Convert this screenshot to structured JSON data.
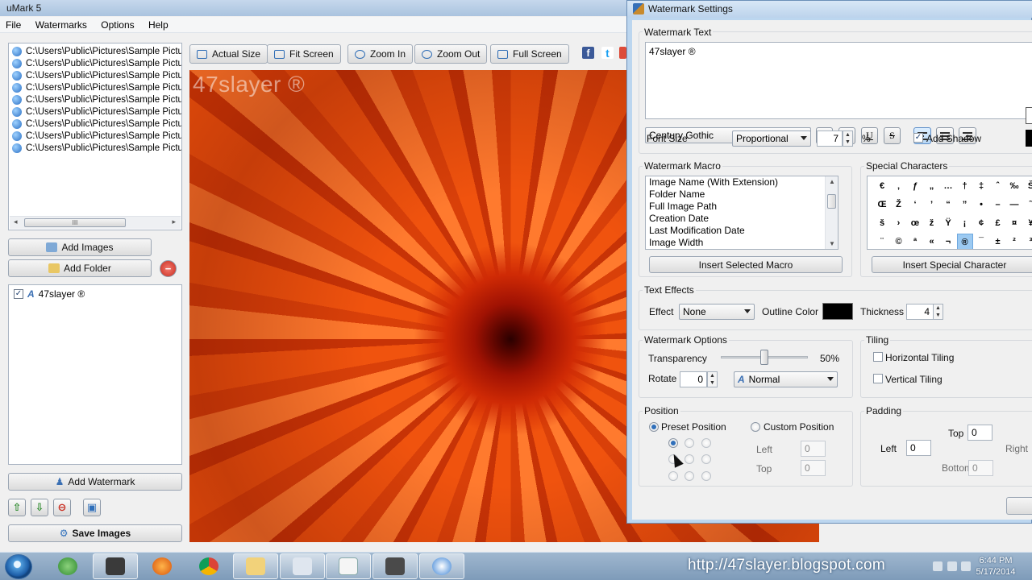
{
  "app": {
    "title": "uMark 5"
  },
  "menu": [
    "File",
    "Watermarks",
    "Options",
    "Help"
  ],
  "files": [
    "C:\\Users\\Public\\Pictures\\Sample Pictur",
    "C:\\Users\\Public\\Pictures\\Sample Pictur",
    "C:\\Users\\Public\\Pictures\\Sample Pictur",
    "C:\\Users\\Public\\Pictures\\Sample Pictur",
    "C:\\Users\\Public\\Pictures\\Sample Pictur",
    "C:\\Users\\Public\\Pictures\\Sample Pictur",
    "C:\\Users\\Public\\Pictures\\Sample Pictur",
    "C:\\Users\\Public\\Pictures\\Sample Pictur",
    "C:\\Users\\Public\\Pictures\\Sample Pictur"
  ],
  "scroll_thumb_label": "III",
  "left_buttons": {
    "add_images": "Add Images",
    "add_folder": "Add Folder",
    "add_watermark": "Add Watermark",
    "save_images": "Save Images"
  },
  "watermarks": [
    {
      "name": "47slayer ®",
      "checked": true
    }
  ],
  "toolbar": {
    "actual_size": "Actual Size",
    "fit_screen": "Fit Screen",
    "zoom_in": "Zoom In",
    "zoom_out": "Zoom Out",
    "full_screen": "Full Screen"
  },
  "preview": {
    "watermark_text": "47slayer ®"
  },
  "dialog": {
    "title": "Watermark Settings",
    "watermark_text_label": "Watermark Text",
    "watermark_text": "47slayer ®",
    "font": "Century Gothic",
    "format": {
      "bold": "B",
      "italic": "I",
      "underline": "U",
      "strike": "S"
    },
    "font_size_label": "Font Size",
    "font_size_mode": "Proportional",
    "font_size_value": "7",
    "font_size_unit": "%",
    "add_shadow_label": "Add Shadow",
    "add_shadow": true,
    "macro_label": "Watermark Macro",
    "macros": [
      "Image Name (With Extension)",
      "Folder Name",
      "Full Image Path",
      "Creation Date",
      "Last Modification Date",
      "Image Width"
    ],
    "insert_macro": "Insert Selected Macro",
    "special_label": "Special Characters",
    "special_rows": [
      [
        "€",
        "‚",
        "ƒ",
        "„",
        "…",
        "†",
        "‡",
        "ˆ",
        "‰",
        "Š"
      ],
      [
        "Œ",
        "Ž",
        "‘",
        "’",
        "“",
        "”",
        "•",
        "–",
        "—",
        "˜"
      ],
      [
        "š",
        "›",
        "œ",
        "ž",
        "Ÿ",
        "¡",
        "¢",
        "£",
        "¤",
        "¥"
      ],
      [
        "¨",
        "©",
        "ª",
        "«",
        "¬",
        "®",
        "¯",
        "±",
        "²",
        "³"
      ]
    ],
    "selected_char": "®",
    "insert_special": "Insert Special Character",
    "text_effects_label": "Text Effects",
    "effect_label": "Effect",
    "effect_value": "None",
    "outline_color_label": "Outline Color",
    "outline_color": "#000000",
    "thickness_label": "Thickness",
    "thickness_value": "4",
    "options_label": "Watermark Options",
    "transparency_label": "Transparency",
    "transparency_text": "50%",
    "transparency_value": 50,
    "rotate_label": "Rotate",
    "rotate_value": "0",
    "blend_mode": "Normal",
    "tiling_label": "Tiling",
    "horizontal_tiling": "Horizontal Tiling",
    "vertical_tiling": "Vertical Tiling",
    "position_label": "Position",
    "preset_position": "Preset Position",
    "custom_position": "Custom Position",
    "pos_left_label": "Left",
    "pos_left_value": "0",
    "pos_top_label": "Top",
    "pos_top_value": "0",
    "padding_label": "Padding",
    "pad_top_label": "Top",
    "pad_top_value": "0",
    "pad_left_label": "Left",
    "pad_left_value": "0",
    "pad_right_label": "Right",
    "pad_bottom_label": "Bottom",
    "pad_bottom_value": "0"
  },
  "taskbar": {
    "blog": "http://47slayer.blogspot.com",
    "time": "6:44 PM",
    "date": "5/17/2014"
  },
  "colors": {
    "accent": "#2f6fba",
    "preview_base": "#e4480b",
    "dialog_frame": "#bcd6ef"
  }
}
